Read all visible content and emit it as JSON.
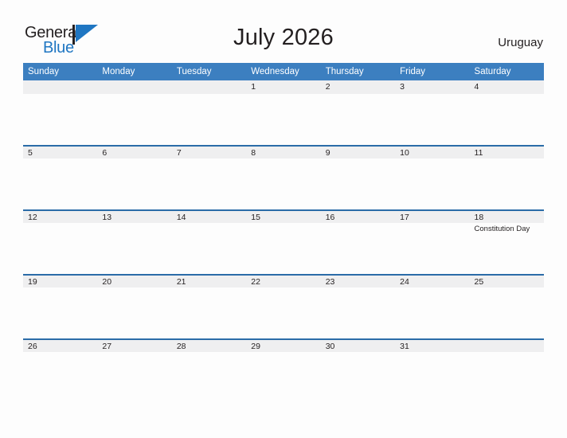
{
  "brand": {
    "word_one": "General",
    "word_two": "Blue",
    "logo_icon": "flag-triangle-icon",
    "accent_color": "#1f76c2"
  },
  "header": {
    "title": "July 2026",
    "country": "Uruguay"
  },
  "colors": {
    "header_row_bg": "#3c7fc0",
    "date_strip_bg": "#efeff0",
    "week_border": "#2b6ca8",
    "page_bg": "#fdfdfd",
    "text": "#231f20"
  },
  "calendar": {
    "day_headers": [
      "Sunday",
      "Monday",
      "Tuesday",
      "Wednesday",
      "Thursday",
      "Friday",
      "Saturday"
    ],
    "weeks": [
      {
        "days": [
          {
            "date": "",
            "event": ""
          },
          {
            "date": "",
            "event": ""
          },
          {
            "date": "",
            "event": ""
          },
          {
            "date": "1",
            "event": ""
          },
          {
            "date": "2",
            "event": ""
          },
          {
            "date": "3",
            "event": ""
          },
          {
            "date": "4",
            "event": ""
          }
        ]
      },
      {
        "days": [
          {
            "date": "5",
            "event": ""
          },
          {
            "date": "6",
            "event": ""
          },
          {
            "date": "7",
            "event": ""
          },
          {
            "date": "8",
            "event": ""
          },
          {
            "date": "9",
            "event": ""
          },
          {
            "date": "10",
            "event": ""
          },
          {
            "date": "11",
            "event": ""
          }
        ]
      },
      {
        "days": [
          {
            "date": "12",
            "event": ""
          },
          {
            "date": "13",
            "event": ""
          },
          {
            "date": "14",
            "event": ""
          },
          {
            "date": "15",
            "event": ""
          },
          {
            "date": "16",
            "event": ""
          },
          {
            "date": "17",
            "event": ""
          },
          {
            "date": "18",
            "event": "Constitution Day"
          }
        ]
      },
      {
        "days": [
          {
            "date": "19",
            "event": ""
          },
          {
            "date": "20",
            "event": ""
          },
          {
            "date": "21",
            "event": ""
          },
          {
            "date": "22",
            "event": ""
          },
          {
            "date": "23",
            "event": ""
          },
          {
            "date": "24",
            "event": ""
          },
          {
            "date": "25",
            "event": ""
          }
        ]
      },
      {
        "days": [
          {
            "date": "26",
            "event": ""
          },
          {
            "date": "27",
            "event": ""
          },
          {
            "date": "28",
            "event": ""
          },
          {
            "date": "29",
            "event": ""
          },
          {
            "date": "30",
            "event": ""
          },
          {
            "date": "31",
            "event": ""
          },
          {
            "date": "",
            "event": ""
          }
        ]
      }
    ]
  }
}
